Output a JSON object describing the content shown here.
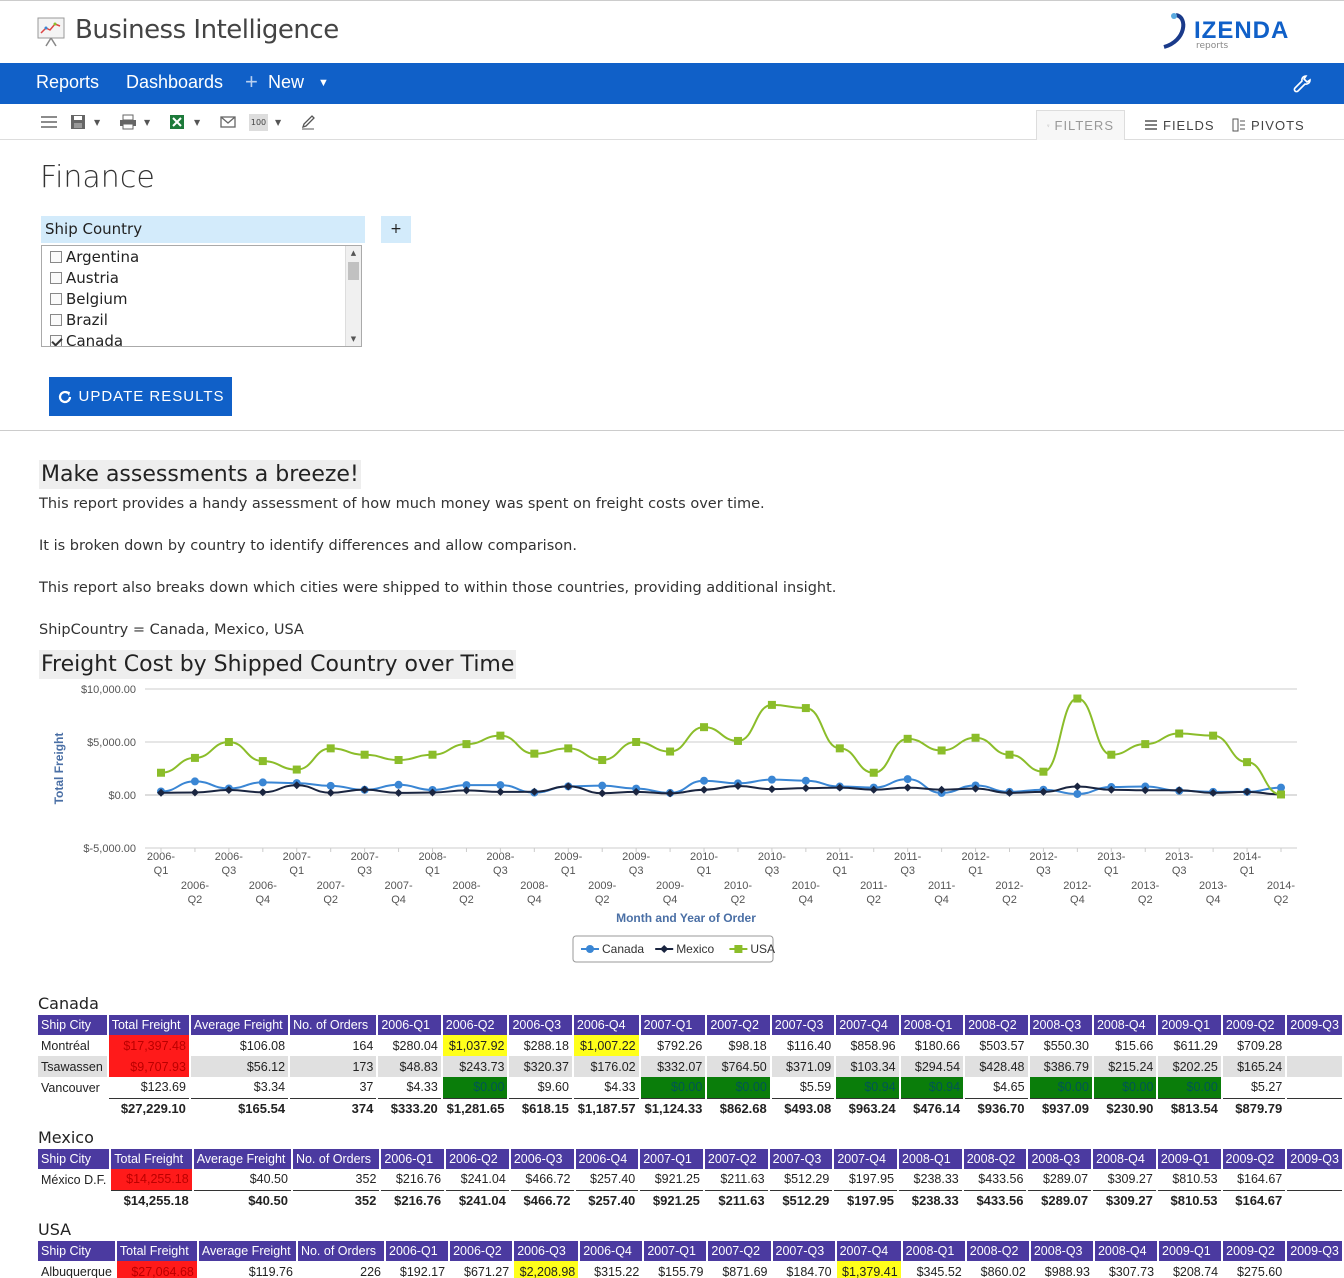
{
  "app": {
    "title": "Business Intelligence",
    "brand": "IZENDA",
    "brand_sub": "reports"
  },
  "nav": {
    "reports": "Reports",
    "dashboards": "Dashboards",
    "new": "New"
  },
  "toolbar": {
    "zoom": "100",
    "tabs": [
      "FILTERS",
      "FIELDS",
      "PIVOTS"
    ]
  },
  "page": {
    "title": "Finance"
  },
  "filter": {
    "field": "Ship Country",
    "add": "+",
    "options": [
      {
        "label": "Argentina",
        "checked": false
      },
      {
        "label": "Austria",
        "checked": false
      },
      {
        "label": "Belgium",
        "checked": false
      },
      {
        "label": "Brazil",
        "checked": false
      },
      {
        "label": "Canada",
        "checked": true
      }
    ],
    "update_label": "UPDATE RESULTS"
  },
  "report": {
    "heading": "Make assessments a breeze!",
    "p1": "This report provides a handy assessment of how much money was spent on freight costs over time.",
    "p2": "It is broken down by country to identify differences and allow comparison.",
    "p3": "This report also breaks down which cities were shipped to within those countries, providing additional insight.",
    "filter_summary": "ShipCountry = Canada, Mexico, USA",
    "chart_heading": "Freight Cost by Shipped Country over Time"
  },
  "chart_data": {
    "type": "line",
    "title": "",
    "xlabel": "Month and Year of Order",
    "ylabel": "Total Freight",
    "ylim": [
      -5000,
      10000
    ],
    "yticks": [
      "$10,000.00",
      "$5,000.00",
      "$0.00",
      "$-5,000.00"
    ],
    "ytick_values": [
      10000,
      5000,
      0,
      -5000
    ],
    "categories": [
      "2006-Q1",
      "2006-Q2",
      "2006-Q3",
      "2006-Q4",
      "2007-Q1",
      "2007-Q2",
      "2007-Q3",
      "2007-Q4",
      "2008-Q1",
      "2008-Q2",
      "2008-Q3",
      "2008-Q4",
      "2009-Q1",
      "2009-Q2",
      "2009-Q3",
      "2009-Q4",
      "2010-Q1",
      "2010-Q2",
      "2010-Q3",
      "2010-Q4",
      "2011-Q1",
      "2011-Q2",
      "2011-Q3",
      "2011-Q4",
      "2012-Q1",
      "2012-Q2",
      "2012-Q3",
      "2012-Q4",
      "2013-Q1",
      "2013-Q2",
      "2013-Q3",
      "2013-Q4",
      "2014-Q1",
      "2014-Q2"
    ],
    "series": [
      {
        "name": "Canada",
        "color": "#3a86d4",
        "marker": "circle",
        "values": [
          333,
          1282,
          618,
          1188,
          1124,
          863,
          493,
          963,
          476,
          937,
          937,
          231,
          814,
          880,
          600,
          200,
          1350,
          1100,
          1450,
          1350,
          800,
          700,
          1500,
          200,
          900,
          300,
          500,
          100,
          750,
          800,
          400,
          300,
          300,
          700
        ]
      },
      {
        "name": "Mexico",
        "color": "#1a2540",
        "marker": "diamond",
        "values": [
          217,
          241,
          467,
          257,
          921,
          212,
          512,
          198,
          238,
          434,
          289,
          309,
          811,
          165,
          300,
          150,
          500,
          850,
          550,
          650,
          700,
          500,
          700,
          500,
          600,
          200,
          300,
          800,
          500,
          450,
          450,
          200,
          300,
          50
        ]
      },
      {
        "name": "USA",
        "color": "#8bbd2a",
        "marker": "square",
        "values": [
          2100,
          3500,
          5000,
          3200,
          2400,
          4400,
          3800,
          3300,
          3800,
          4800,
          5600,
          3900,
          4400,
          3300,
          5000,
          4100,
          6400,
          5100,
          8500,
          8200,
          4400,
          2100,
          5300,
          4200,
          5400,
          3800,
          2200,
          9100,
          3800,
          4800,
          5800,
          5600,
          3100,
          50
        ]
      }
    ],
    "legend_position": "bottom-center",
    "grid": true
  },
  "tables": [
    {
      "country": "Canada",
      "headers": [
        "Ship City",
        "Total Freight",
        "Average Freight",
        "No. of Orders",
        "2006-Q1",
        "2006-Q2",
        "2006-Q3",
        "2006-Q4",
        "2007-Q1",
        "2007-Q2",
        "2007-Q3",
        "2007-Q4",
        "2008-Q1",
        "2008-Q2",
        "2008-Q3",
        "2008-Q4",
        "2009-Q1",
        "2009-Q2",
        "2009-Q3"
      ],
      "rows": [
        {
          "cells": [
            "Montréal",
            "$17,397.48",
            "$106.08",
            "164",
            "$280.04",
            "$1,037.92",
            "$288.18",
            "$1,007.22",
            "$792.26",
            "$98.18",
            "$116.40",
            "$858.96",
            "$180.66",
            "$503.57",
            "$550.30",
            "$15.66",
            "$611.29",
            "$709.28",
            ""
          ],
          "hl": {
            "1": "red",
            "5": "yel",
            "7": "yel"
          }
        },
        {
          "cells": [
            "Tsawassen",
            "$9,707.93",
            "$56.12",
            "173",
            "$48.83",
            "$243.73",
            "$320.37",
            "$176.02",
            "$332.07",
            "$764.50",
            "$371.09",
            "$103.34",
            "$294.54",
            "$428.48",
            "$386.79",
            "$215.24",
            "$202.25",
            "$165.24",
            ""
          ],
          "hl": {
            "1": "red"
          }
        },
        {
          "cells": [
            "Vancouver",
            "$123.69",
            "$3.34",
            "37",
            "$4.33",
            "$0.00",
            "$9.60",
            "$4.33",
            "$0.00",
            "$0.00",
            "$5.59",
            "$0.94",
            "$0.94",
            "$4.65",
            "$0.00",
            "$0.00",
            "$0.00",
            "$5.27",
            ""
          ],
          "hl": {
            "5": "grn",
            "8": "grn",
            "9": "grn",
            "11": "grn",
            "12": "grn",
            "14": "grn",
            "15": "grn",
            "16": "grn"
          }
        }
      ],
      "total": [
        "",
        "$27,229.10",
        "$165.54",
        "374",
        "$333.20",
        "$1,281.65",
        "$618.15",
        "$1,187.57",
        "$1,124.33",
        "$862.68",
        "$493.08",
        "$963.24",
        "$476.14",
        "$936.70",
        "$937.09",
        "$230.90",
        "$813.54",
        "$879.79",
        ""
      ]
    },
    {
      "country": "Mexico",
      "headers": [
        "Ship City",
        "Total Freight",
        "Average Freight",
        "No. of Orders",
        "2006-Q1",
        "2006-Q2",
        "2006-Q3",
        "2006-Q4",
        "2007-Q1",
        "2007-Q2",
        "2007-Q3",
        "2007-Q4",
        "2008-Q1",
        "2008-Q2",
        "2008-Q3",
        "2008-Q4",
        "2009-Q1",
        "2009-Q2",
        "2009-Q3"
      ],
      "rows": [
        {
          "cells": [
            "México D.F.",
            "$14,255.18",
            "$40.50",
            "352",
            "$216.76",
            "$241.04",
            "$466.72",
            "$257.40",
            "$921.25",
            "$211.63",
            "$512.29",
            "$197.95",
            "$238.33",
            "$433.56",
            "$289.07",
            "$309.27",
            "$810.53",
            "$164.67",
            ""
          ],
          "hl": {
            "1": "red"
          }
        }
      ],
      "total": [
        "",
        "$14,255.18",
        "$40.50",
        "352",
        "$216.76",
        "$241.04",
        "$466.72",
        "$257.40",
        "$921.25",
        "$211.63",
        "$512.29",
        "$197.95",
        "$238.33",
        "$433.56",
        "$289.07",
        "$309.27",
        "$810.53",
        "$164.67",
        ""
      ]
    },
    {
      "country": "USA",
      "headers": [
        "Ship City",
        "Total Freight",
        "Average Freight",
        "No. of Orders",
        "2006-Q1",
        "2006-Q2",
        "2006-Q3",
        "2006-Q4",
        "2007-Q1",
        "2007-Q2",
        "2007-Q3",
        "2007-Q4",
        "2008-Q1",
        "2008-Q2",
        "2008-Q3",
        "2008-Q4",
        "2009-Q1",
        "2009-Q2",
        "2009-Q3"
      ],
      "rows": [
        {
          "cells": [
            "Albuquerque",
            "$27,064.68",
            "$119.76",
            "226",
            "$192.17",
            "$671.27",
            "$2,208.98",
            "$315.22",
            "$155.79",
            "$871.69",
            "$184.70",
            "$1,379.41",
            "$345.52",
            "$860.02",
            "$988.93",
            "$307.73",
            "$208.74",
            "$275.60",
            ""
          ],
          "hl": {
            "1": "red",
            "6": "yel",
            "11": "yel"
          }
        }
      ],
      "total": null
    }
  ]
}
